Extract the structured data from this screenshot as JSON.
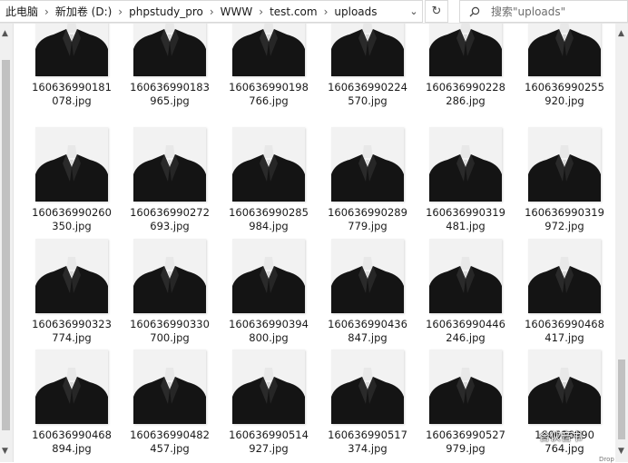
{
  "breadcrumb": [
    "此电脑",
    "新加卷 (D:)",
    "phpstudy_pro",
    "WWW",
    "test.com",
    "uploads"
  ],
  "search": {
    "placeholder": "搜索\"uploads\""
  },
  "files": [
    [
      "160636990181",
      "078.jpg"
    ],
    [
      "160636990183",
      "965.jpg"
    ],
    [
      "160636990198",
      "766.jpg"
    ],
    [
      "160636990224",
      "570.jpg"
    ],
    [
      "160636990228",
      "286.jpg"
    ],
    [
      "160636990255",
      "920.jpg"
    ],
    [
      "160636990260",
      "350.jpg"
    ],
    [
      "160636990272",
      "693.jpg"
    ],
    [
      "160636990285",
      "984.jpg"
    ],
    [
      "160636990289",
      "779.jpg"
    ],
    [
      "160636990319",
      "481.jpg"
    ],
    [
      "160636990319",
      "972.jpg"
    ],
    [
      "160636990323",
      "774.jpg"
    ],
    [
      "160636990330",
      "700.jpg"
    ],
    [
      "160636990394",
      "800.jpg"
    ],
    [
      "160636990436",
      "847.jpg"
    ],
    [
      "160636990446",
      "246.jpg"
    ],
    [
      "160636990468",
      "417.jpg"
    ],
    [
      "160636990468",
      "894.jpg"
    ],
    [
      "160636990482",
      "457.jpg"
    ],
    [
      "160636990514",
      "927.jpg"
    ],
    [
      "160636990517",
      "374.jpg"
    ],
    [
      "160636990527",
      "979.jpg"
    ],
    [
      "160636990",
      "764.jpg"
    ]
  ],
  "watermark": {
    "text": "合伙音书",
    "icon": "wechat-icon"
  },
  "bottom_hint": "Drop",
  "icons": {
    "breadcrumb_separator": "chevron-right-icon",
    "dropdown": "chevron-down-icon",
    "refresh": "refresh-icon",
    "search": "search-icon",
    "scroll_up": "scroll-up-icon",
    "scroll_down": "scroll-down-icon"
  },
  "colors": {
    "thumb_bg": "#f2f2f2",
    "jacket": "#141414",
    "scrollbar_thumb": "#c1c1c1"
  }
}
